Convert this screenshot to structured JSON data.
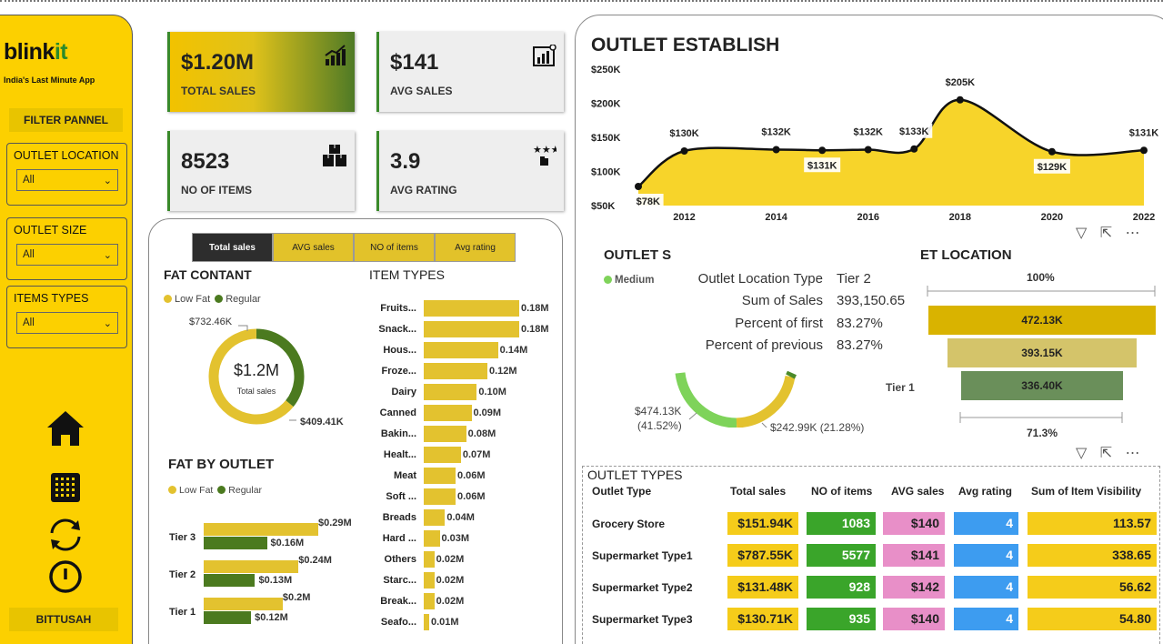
{
  "sidebar": {
    "logo_main": "blink",
    "logo_accent": "it",
    "tagline": "India's Last Minute App",
    "filter_title": "FILTER PANNEL",
    "slicers": [
      {
        "label": "OUTLET LOCATION",
        "value": "All"
      },
      {
        "label": "OUTLET SIZE",
        "value": "All"
      },
      {
        "label": "ITEMS TYPES",
        "value": "All"
      }
    ],
    "user": "BITTUSAH"
  },
  "kpis": [
    {
      "value": "$1.20M",
      "caption": "TOTAL SALES",
      "icon": "sales-chart-icon"
    },
    {
      "value": "$141",
      "caption": "AVG SALES",
      "icon": "bar-chart-icon"
    },
    {
      "value": "8523",
      "caption": "NO OF ITEMS",
      "icon": "boxes-icon"
    },
    {
      "value": "3.9",
      "caption": "AVG RATING",
      "icon": "rating-icon"
    }
  ],
  "tabs": [
    "Total sales",
    "AVG sales",
    "NO of items",
    "Avg rating"
  ],
  "fat_content": {
    "title": "FAT CONTANT",
    "legend": [
      "Low Fat",
      "Regular"
    ],
    "center_value": "$1.2M",
    "center_caption": "Total sales",
    "low_fat_label": "$732.46K",
    "regular_label": "$409.41K",
    "colors": {
      "low_fat": "#e3c22f",
      "regular": "#4b7a1f"
    }
  },
  "item_types": {
    "title": "ITEM TYPES",
    "items": [
      {
        "name": "Fruits...",
        "value": 0.18,
        "label": "0.18M"
      },
      {
        "name": "Snack...",
        "value": 0.18,
        "label": "0.18M"
      },
      {
        "name": "Hous...",
        "value": 0.14,
        "label": "0.14M"
      },
      {
        "name": "Froze...",
        "value": 0.12,
        "label": "0.12M"
      },
      {
        "name": "Dairy",
        "value": 0.1,
        "label": "0.10M"
      },
      {
        "name": "Canned",
        "value": 0.09,
        "label": "0.09M"
      },
      {
        "name": "Bakin...",
        "value": 0.08,
        "label": "0.08M"
      },
      {
        "name": "Healt...",
        "value": 0.07,
        "label": "0.07M"
      },
      {
        "name": "Meat",
        "value": 0.06,
        "label": "0.06M"
      },
      {
        "name": "Soft ...",
        "value": 0.06,
        "label": "0.06M"
      },
      {
        "name": "Breads",
        "value": 0.04,
        "label": "0.04M"
      },
      {
        "name": "Hard ...",
        "value": 0.03,
        "label": "0.03M"
      },
      {
        "name": "Others",
        "value": 0.02,
        "label": "0.02M"
      },
      {
        "name": "Starc...",
        "value": 0.02,
        "label": "0.02M"
      },
      {
        "name": "Break...",
        "value": 0.02,
        "label": "0.02M"
      },
      {
        "name": "Seafo...",
        "value": 0.01,
        "label": "0.01M"
      }
    ]
  },
  "fat_by_outlet": {
    "title": "FAT BY OUTLET",
    "legend": [
      "Low Fat",
      "Regular"
    ],
    "rows": [
      {
        "tier": "Tier 3",
        "low": 0.29,
        "reg": 0.16,
        "low_label": "$0.29M",
        "reg_label": "$0.16M"
      },
      {
        "tier": "Tier 2",
        "low": 0.24,
        "reg": 0.13,
        "low_label": "$0.24M",
        "reg_label": "$0.13M"
      },
      {
        "tier": "Tier 1",
        "low": 0.2,
        "reg": 0.12,
        "low_label": "$0.2M",
        "reg_label": "$0.12M"
      }
    ]
  },
  "outlet_establish": {
    "title": "OUTLET ESTABLISH",
    "y_ticks": [
      "$250K",
      "$200K",
      "$150K",
      "$100K",
      "$50K"
    ],
    "x_ticks": [
      "2012",
      "2014",
      "2016",
      "2018",
      "2020",
      "2022"
    ]
  },
  "chart_data": {
    "type": "area",
    "title": "OUTLET ESTABLISH",
    "x": [
      2011,
      2012,
      2014,
      2015,
      2016,
      2017,
      2018,
      2020,
      2022
    ],
    "values": [
      78,
      130,
      132,
      131,
      132,
      133,
      205,
      129,
      131
    ],
    "labels": [
      "$78K",
      "$130K",
      "$132K",
      "$131K",
      "$132K",
      "$133K",
      "$205K",
      "$129K",
      "$131K"
    ],
    "ylim": [
      50,
      250
    ],
    "xlim": [
      2011,
      2022
    ],
    "fill": "#f7d42a"
  },
  "outlet_size": {
    "title_partial": "OUTLET S",
    "legend_item": "Medium",
    "left_label": "$474.13K",
    "left_pct": "(41.52%)",
    "right_label": "$242.99K (21.28%)"
  },
  "outlet_location": {
    "title_partial": "ET LOCATION",
    "top_pct": "100%",
    "bottom_pct": "71.3%",
    "tier_label": "Tier 1",
    "bars": [
      {
        "label": "472.13K",
        "value": 472.13,
        "color": "#d9b300"
      },
      {
        "label": "393.15K",
        "value": 393.15,
        "color": "#d4c46a"
      },
      {
        "label": "336.40K",
        "value": 336.4,
        "color": "#6a8f5a"
      }
    ]
  },
  "tooltip": {
    "rows": [
      {
        "key": "Outlet Location Type",
        "value": "Tier 2"
      },
      {
        "key": "Sum of Sales",
        "value": "393,150.65"
      },
      {
        "key": "Percent of first",
        "value": "83.27%"
      },
      {
        "key": "Percent of previous",
        "value": "83.27%"
      }
    ]
  },
  "outlet_types": {
    "title": "OUTLET TYPES",
    "headers": [
      "Outlet Type",
      "Total sales",
      "NO of items",
      "AVG sales",
      "Avg rating",
      "Sum of Item Visibility"
    ],
    "rows": [
      [
        "Grocery Store",
        "$151.94K",
        "1083",
        "$140",
        "4",
        "113.57"
      ],
      [
        "Supermarket Type1",
        "$787.55K",
        "5577",
        "$141",
        "4",
        "338.65"
      ],
      [
        "Supermarket Type2",
        "$131.48K",
        "928",
        "$142",
        "4",
        "56.62"
      ],
      [
        "Supermarket Type3",
        "$130.71K",
        "935",
        "$140",
        "4",
        "54.80"
      ]
    ],
    "colors": {
      "sales": "#f5cc1a",
      "items": "#3aa52a",
      "avg": "#e88fc8",
      "rating": "#3d9cf0",
      "visibility": "#f5cc1a"
    }
  }
}
